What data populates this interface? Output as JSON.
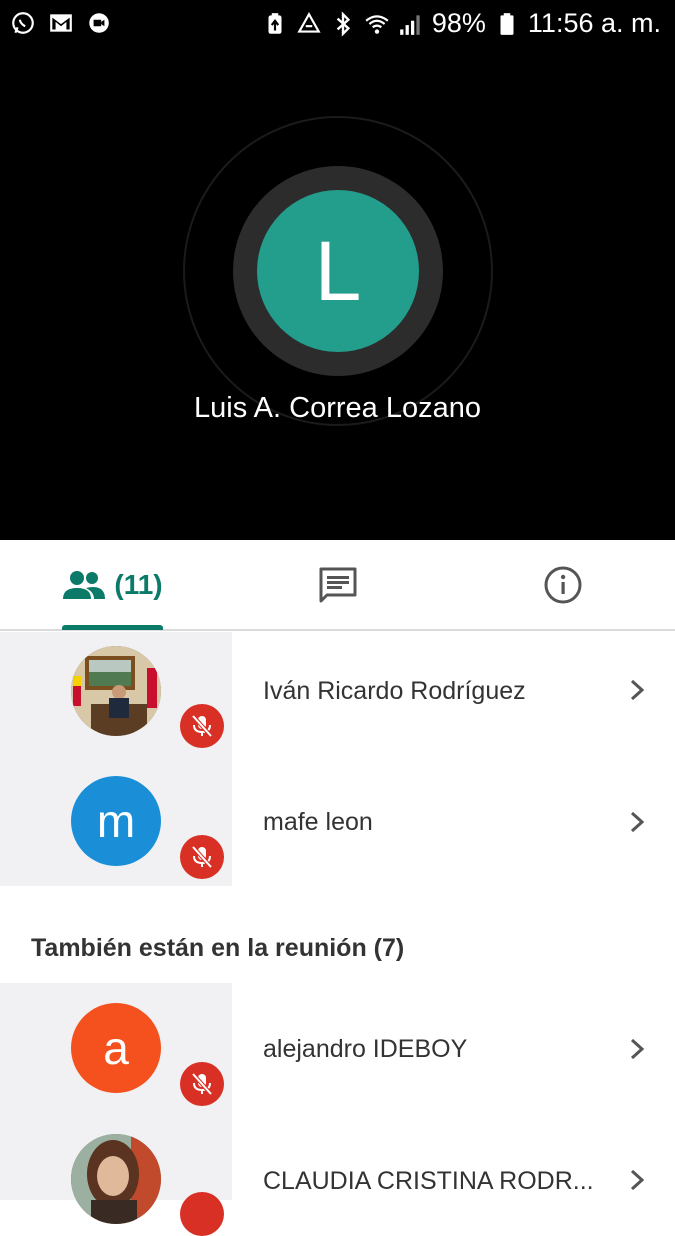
{
  "status_bar": {
    "battery": "98%",
    "time": "11:56 a. m."
  },
  "speaker": {
    "initial": "L",
    "name": "Luis A. Correa Lozano"
  },
  "tabs": {
    "people_count": "(11)"
  },
  "participants": [
    {
      "name": "Iván Ricardo Rodríguez",
      "initial": "",
      "color": "#6b5a3a"
    },
    {
      "name": "mafe leon",
      "initial": "m",
      "color": "#1a8fd8"
    }
  ],
  "section": {
    "title": "También están en la reunión (7)"
  },
  "others": [
    {
      "name": "alejandro IDEBOY",
      "initial": "a",
      "color": "#f4511e"
    },
    {
      "name": "CLAUDIA CRISTINA RODR...",
      "initial": "",
      "color": "#8a6d5a"
    }
  ],
  "colors": {
    "accent": "#0b7a68",
    "speaker_avatar": "#239e8d",
    "mute": "#d93025"
  }
}
